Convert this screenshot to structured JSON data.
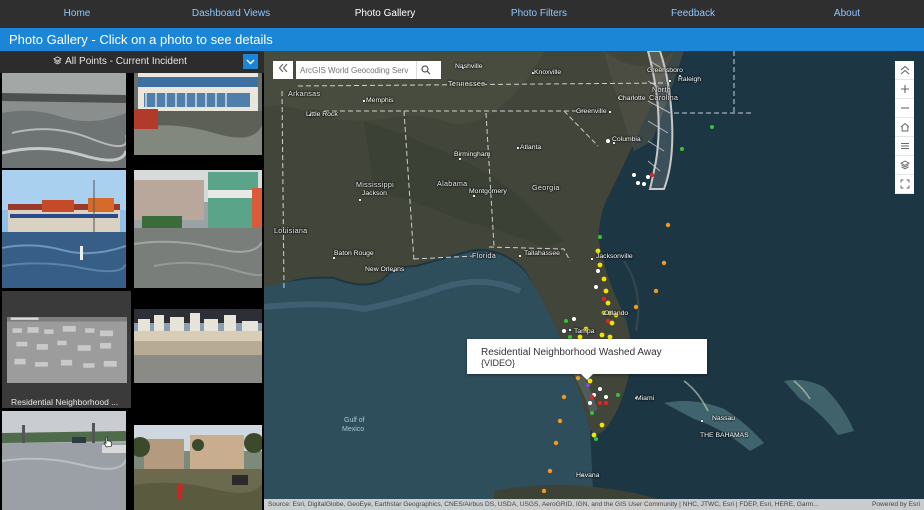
{
  "nav": {
    "items": [
      {
        "label": "Home",
        "active": false
      },
      {
        "label": "Dashboard Views",
        "active": false
      },
      {
        "label": "Photo Gallery",
        "active": true
      },
      {
        "label": "Photo Filters",
        "active": false
      },
      {
        "label": "Feedback",
        "active": false
      },
      {
        "label": "About",
        "active": false
      }
    ]
  },
  "banner": {
    "title": "Photo Gallery - Click on a photo to see details"
  },
  "gallery": {
    "filter_label": "All Points - Current Incident",
    "hover_caption": "Residential Neighborhood ..."
  },
  "map": {
    "search_placeholder": "ArcGIS World Geocoding Serv",
    "popup": {
      "title": "Residential Neighborhood Washed Away",
      "subtitle": "{VIDEO}"
    },
    "attribution": "Source: Esri, DigitalGlobe, GeoEye, Earthstar Geographics, CNES/Airbus DS, USDA, USGS, AeroGRID, IGN, and the GIS User Community | NHC, JTWC, Esri | FDEP, Esri, HERE, Garm...",
    "powered_by": "Powered by Esri",
    "labels": {
      "nashville": "Nashville",
      "knoxville": "Knoxville",
      "greensboro": "Greensboro",
      "raleigh": "Raleigh",
      "north": "North",
      "carolina": "Carolina",
      "charlotte": "Charlotte",
      "arkansas": "Arkansas",
      "memphis": "Memphis",
      "tennessee": "Tennessee",
      "little_rock": "Little Rock",
      "greenville": "Greenville",
      "columbia": "Columbia",
      "atlanta": "Atlanta",
      "birmingham": "Birmingham",
      "mississippi": "Mississippi",
      "alabama": "Alabama",
      "georgia": "Georgia",
      "jackson": "Jackson",
      "montgomery": "Montgomery",
      "louisiana": "Louisiana",
      "baton_rouge": "Baton Rouge",
      "florida": "Florida",
      "tallahassee": "Tallahassee",
      "jacksonville": "Jacksonville",
      "new_orleans": "New Orleans",
      "orlando": "Orlando",
      "tampa": "Tampa",
      "miami": "Miami",
      "gulf_of": "Gulf of",
      "mexico": "Mexico",
      "nassau": "Nassau",
      "the_bahamas": "THE BAHAMAS",
      "havana": "Havana"
    }
  },
  "colors": {
    "nav_bg": "#2f2f2f",
    "nav_link": "#8fc7ff",
    "banner": "#1b86d6",
    "point_orange": "#f39a1e",
    "point_yellow": "#f2e400",
    "point_green": "#38c238",
    "point_red": "#e02424",
    "point_white": "#ffffff"
  }
}
